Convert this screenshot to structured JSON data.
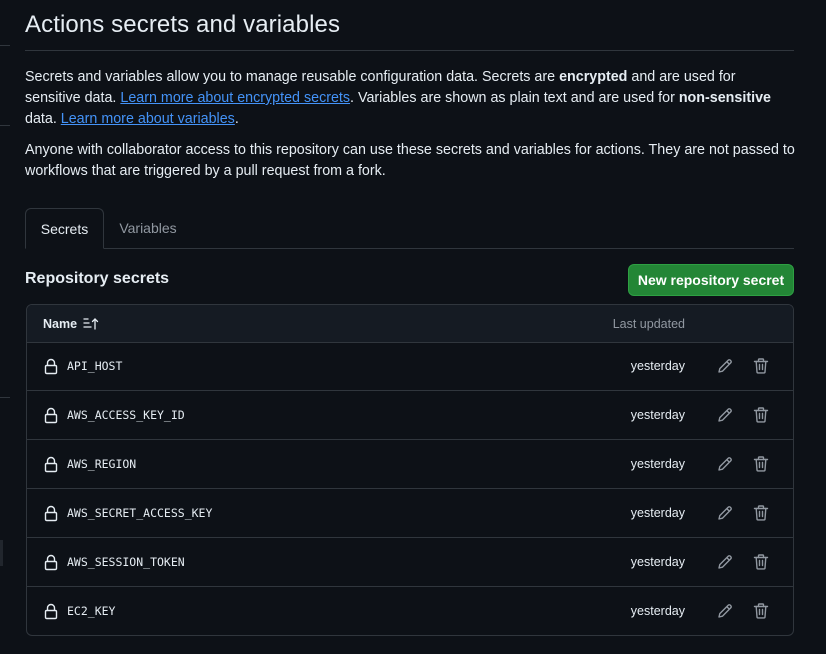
{
  "page": {
    "title": "Actions secrets and variables",
    "intro": {
      "t1": "Secrets and variables allow you to manage reusable configuration data. Secrets are ",
      "b1": "encrypted",
      "t2": " and are used for sensitive data. ",
      "link1": "Learn more about encrypted secrets",
      "t3": ". Variables are shown as plain text and are used for ",
      "b2": "non-sensitive",
      "t4": " data. ",
      "link2": "Learn more about variables",
      "t5": "."
    },
    "note": "Anyone with collaborator access to this repository can use these secrets and variables for actions. They are not passed to workflows that are triggered by a pull request from a fork."
  },
  "tabs": [
    {
      "label": "Secrets",
      "active": true
    },
    {
      "label": "Variables",
      "active": false
    }
  ],
  "section": {
    "title": "Repository secrets",
    "new_button": "New repository secret"
  },
  "table": {
    "col_name": "Name",
    "col_updated": "Last updated",
    "rows": [
      {
        "name": "API_HOST",
        "updated": "yesterday"
      },
      {
        "name": "AWS_ACCESS_KEY_ID",
        "updated": "yesterday"
      },
      {
        "name": "AWS_REGION",
        "updated": "yesterday"
      },
      {
        "name": "AWS_SECRET_ACCESS_KEY",
        "updated": "yesterday"
      },
      {
        "name": "AWS_SESSION_TOKEN",
        "updated": "yesterday"
      },
      {
        "name": "EC2_KEY",
        "updated": "yesterday"
      }
    ]
  },
  "icons": {
    "lock": "lock-icon",
    "edit": "pencil-icon",
    "delete": "trash-icon",
    "sort": "sort-ascending-icon"
  },
  "colors": {
    "background": "#0d1117",
    "text": "#e6edf3",
    "muted": "#9198a1",
    "link": "#4493f8",
    "primary_button": "#238636",
    "border": "#30363d"
  }
}
